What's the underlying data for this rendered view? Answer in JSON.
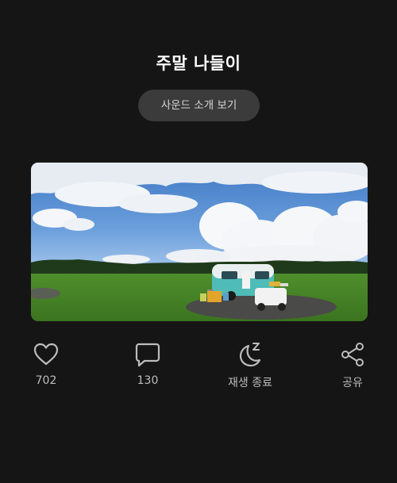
{
  "page": {
    "title": "주말 나들이",
    "sound_intro_label": "사운드 소개 보기"
  },
  "cover_image": {
    "description_name": "campsite-photo"
  },
  "actions": {
    "like": {
      "icon": "heart-icon",
      "label": "702"
    },
    "comment": {
      "icon": "speech-bubble-icon",
      "label": "130"
    },
    "sleep_timer": {
      "icon": "moon-sleep-icon",
      "label": "재생 종료"
    },
    "share": {
      "icon": "share-icon",
      "label": "공유"
    }
  },
  "colors": {
    "background": "#151515",
    "button_bg": "#3b3b3b",
    "icon": "#bdbdbd"
  }
}
